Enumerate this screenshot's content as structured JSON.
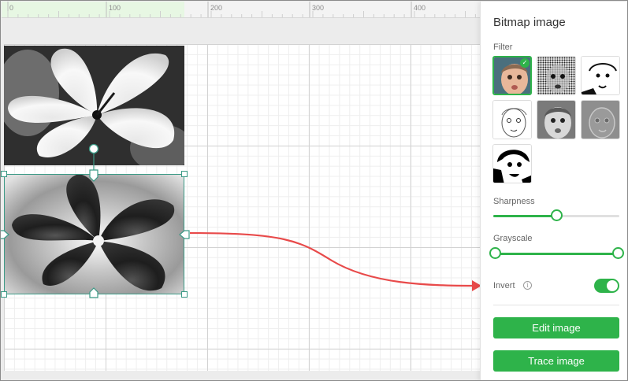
{
  "ruler": {
    "labels": [
      "0",
      "100",
      "200",
      "300",
      "400"
    ]
  },
  "panel": {
    "title": "Bitmap image",
    "filter_label": "Filter",
    "filters": [
      {
        "id": "original",
        "selected": true
      },
      {
        "id": "halftone",
        "selected": false
      },
      {
        "id": "threshold-light",
        "selected": false
      },
      {
        "id": "sketch",
        "selected": false
      },
      {
        "id": "grayscale",
        "selected": false
      },
      {
        "id": "emboss",
        "selected": false
      },
      {
        "id": "threshold-dark",
        "selected": false
      }
    ],
    "sharpness_label": "Sharpness",
    "sharpness_value": 0.5,
    "grayscale_label": "Grayscale",
    "grayscale_range": [
      0,
      1
    ],
    "invert_label": "Invert",
    "invert_info_icon": "i",
    "invert_on": true,
    "edit_button": "Edit image",
    "trace_button": "Trace image"
  },
  "colors": {
    "accent": "#2eb34a",
    "selection": "#3b9a86",
    "arrow": "#e84a4a"
  }
}
